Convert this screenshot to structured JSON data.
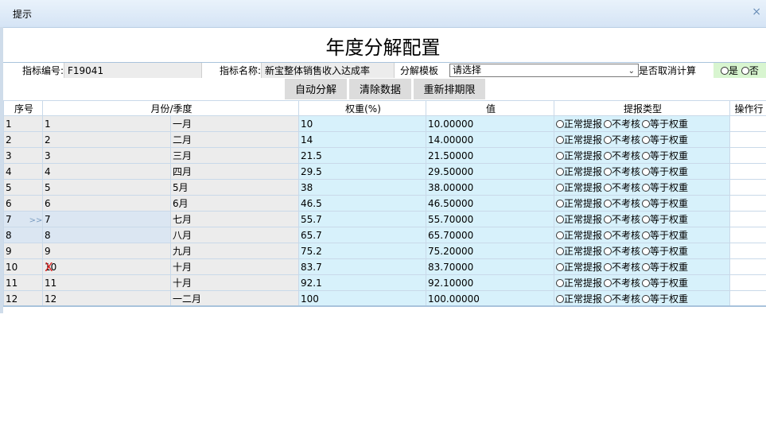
{
  "window": {
    "title": "提示",
    "close": "×"
  },
  "page": {
    "title": "年度分解配置"
  },
  "info": {
    "code_label": "指标编号:",
    "code_value": "F19041",
    "name_label": "指标名称:",
    "name_value": "新宝整体销售收入达成率",
    "template_label": "分解模板",
    "template_value": "请选择",
    "cancel_label": "是否取消计算",
    "yes": "是",
    "no": "否"
  },
  "buttons": {
    "auto": "自动分解",
    "clear": "清除数据",
    "reorder": "重新排期限"
  },
  "columns": {
    "seq": "序号",
    "period": "月份/季度",
    "weight": "权重(%)",
    "value": "值",
    "type": "提报类型",
    "action": "操作行"
  },
  "type_options": [
    "正常提报",
    "不考核",
    "等于权重"
  ],
  "row_marks": {
    "arrow": ">>",
    "delete": "X"
  },
  "rows": [
    {
      "seq": "1",
      "num": "1",
      "period": "一月",
      "weight": "10",
      "value": "10.00000"
    },
    {
      "seq": "2",
      "num": "2",
      "period": "二月",
      "weight": "14",
      "value": "14.00000"
    },
    {
      "seq": "3",
      "num": "3",
      "period": "三月",
      "weight": "21.5",
      "value": "21.50000"
    },
    {
      "seq": "4",
      "num": "4",
      "period": "四月",
      "weight": "29.5",
      "value": "29.50000"
    },
    {
      "seq": "5",
      "num": "5",
      "period": "5月",
      "weight": "38",
      "value": "38.00000"
    },
    {
      "seq": "6",
      "num": "6",
      "period": "6月",
      "weight": "46.5",
      "value": "46.50000"
    },
    {
      "seq": "7",
      "num": "7",
      "period": "七月",
      "weight": "55.7",
      "value": "55.70000"
    },
    {
      "seq": "8",
      "num": "8",
      "period": "八月",
      "weight": "65.7",
      "value": "65.70000"
    },
    {
      "seq": "9",
      "num": "9",
      "period": "九月",
      "weight": "75.2",
      "value": "75.20000"
    },
    {
      "seq": "10",
      "num": "10",
      "period": "十月",
      "weight": "83.7",
      "value": "83.70000"
    },
    {
      "seq": "11",
      "num": "11",
      "period": "十月",
      "weight": "92.1",
      "value": "92.10000"
    },
    {
      "seq": "12",
      "num": "12",
      "period": "一二月",
      "weight": "100",
      "value": "100.00000"
    }
  ]
}
